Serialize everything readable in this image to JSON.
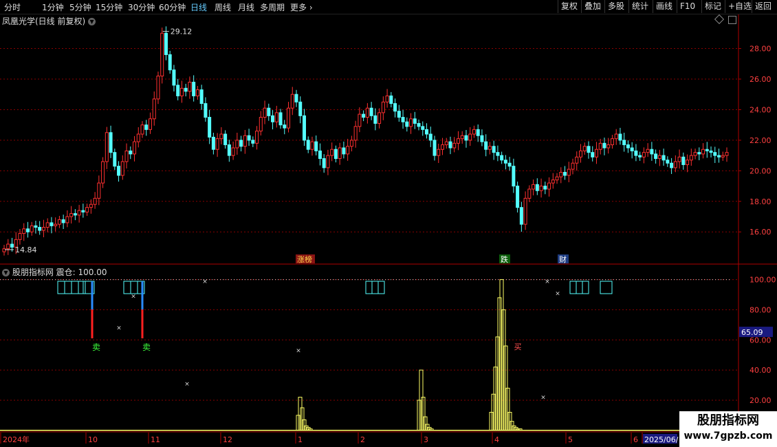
{
  "toolbar": {
    "tabs": [
      "分时",
      "1分钟",
      "5分钟",
      "15分钟",
      "30分钟",
      "60分钟",
      "日线",
      "周线",
      "月线",
      "多周期",
      "更多"
    ],
    "active_tab": "日线",
    "right_buttons": [
      "复权",
      "叠加",
      "多股",
      "统计",
      "画线",
      "F10",
      "标记",
      "+自选",
      "返回"
    ]
  },
  "stock": {
    "name": "凤凰光学(日线 前复权)"
  },
  "indicator": {
    "name": "股朋指标网",
    "label": "震仓: 100.00",
    "current_value_box": "65.09"
  },
  "watermark": {
    "line1": "股朋指标网",
    "line2": "www.7gpzb.com"
  },
  "markers": {
    "zhangbang": "涨榜",
    "die": "跌",
    "cai": "财",
    "sell": "卖",
    "buy": "买"
  },
  "colors": {
    "up": "#ff3030",
    "down": "#54ffff",
    "grid": "#8b0000",
    "indicator": "#ffff66",
    "box": "#54ffff",
    "axis": "#b00000"
  },
  "chart_data": {
    "type": "candlestick",
    "price_axis": {
      "ticks": [
        16.0,
        18.0,
        20.0,
        22.0,
        24.0,
        26.0,
        28.0
      ],
      "ylim": [
        14.3,
        29.6
      ]
    },
    "annotations": {
      "high": "29.12",
      "low": "14.84"
    },
    "x_axis_labels": [
      "2024年",
      "10",
      "11",
      "12",
      "1",
      "2",
      "3",
      "4",
      "5",
      "6",
      "2025/06/"
    ],
    "closes": [
      14.9,
      15.2,
      15.0,
      15.5,
      15.9,
      16.2,
      16.0,
      16.4,
      16.3,
      16.1,
      16.3,
      16.6,
      16.4,
      16.5,
      16.8,
      16.6,
      17.0,
      17.2,
      17.1,
      17.4,
      17.3,
      17.6,
      17.8,
      18.2,
      19.2,
      20.6,
      22.5,
      21.2,
      20.3,
      19.7,
      20.6,
      21.3,
      21.1,
      21.9,
      22.4,
      23.0,
      22.7,
      23.4,
      24.7,
      26.2,
      29.0,
      27.6,
      26.6,
      25.6,
      24.9,
      25.4,
      25.2,
      25.8,
      24.9,
      25.3,
      24.4,
      23.5,
      22.2,
      21.4,
      22.1,
      22.4,
      21.7,
      21.0,
      21.5,
      22.0,
      21.6,
      22.3,
      22.0,
      21.8,
      22.6,
      23.5,
      24.1,
      23.6,
      23.2,
      23.8,
      23.0,
      22.8,
      24.1,
      25.0,
      24.5,
      23.6,
      22.0,
      21.4,
      21.9,
      21.3,
      20.8,
      20.2,
      21.0,
      21.4,
      20.8,
      21.5,
      21.1,
      21.6,
      22.0,
      22.9,
      23.7,
      23.5,
      24.1,
      23.6,
      23.1,
      23.8,
      24.5,
      24.9,
      24.4,
      23.9,
      23.5,
      23.2,
      22.9,
      23.4,
      23.1,
      22.9,
      22.7,
      22.4,
      22.0,
      21.0,
      21.4,
      21.7,
      21.9,
      21.5,
      21.8,
      22.1,
      22.3,
      22.0,
      22.4,
      22.7,
      22.3,
      21.9,
      21.4,
      21.6,
      21.2,
      21.0,
      20.7,
      20.5,
      20.3,
      19.0,
      17.6,
      16.5,
      18.2,
      18.8,
      19.1,
      18.7,
      19.0,
      18.8,
      19.2,
      19.4,
      19.6,
      19.9,
      19.7,
      20.1,
      20.5,
      20.9,
      21.3,
      21.6,
      21.2,
      20.9,
      21.4,
      21.8,
      21.5,
      21.7,
      22.1,
      22.4,
      22.0,
      21.7,
      21.5,
      21.3,
      21.0,
      20.9,
      21.2,
      21.4,
      21.1,
      20.8,
      21.0,
      20.7,
      20.5,
      20.2,
      20.6,
      20.9,
      20.4,
      20.7,
      21.0,
      21.2,
      21.1,
      21.4,
      21.3,
      21.2,
      21.0,
      20.9,
      21.0,
      21.2
    ],
    "indicator_axis": {
      "ticks": [
        20.0,
        40.0,
        60.0,
        80.0,
        100.0
      ],
      "ylim": [
        -1,
        103
      ]
    },
    "peaks": [
      {
        "start": 431,
        "values": [
          10,
          22,
          15,
          7,
          3,
          2,
          1
        ]
      },
      {
        "start": 607,
        "values": [
          20,
          40,
          22,
          9,
          4,
          2,
          1
        ]
      },
      {
        "start": 712,
        "values": [
          12,
          24,
          42,
          62,
          88,
          100,
          80,
          56,
          28,
          12,
          6,
          3,
          2,
          1,
          1
        ]
      }
    ],
    "cross_marks": [
      [
        173,
        68
      ],
      [
        194,
        89
      ],
      [
        272,
        31
      ],
      [
        298,
        99
      ],
      [
        434,
        53
      ],
      [
        790,
        22
      ],
      [
        811,
        91
      ],
      [
        796,
        99
      ]
    ]
  }
}
